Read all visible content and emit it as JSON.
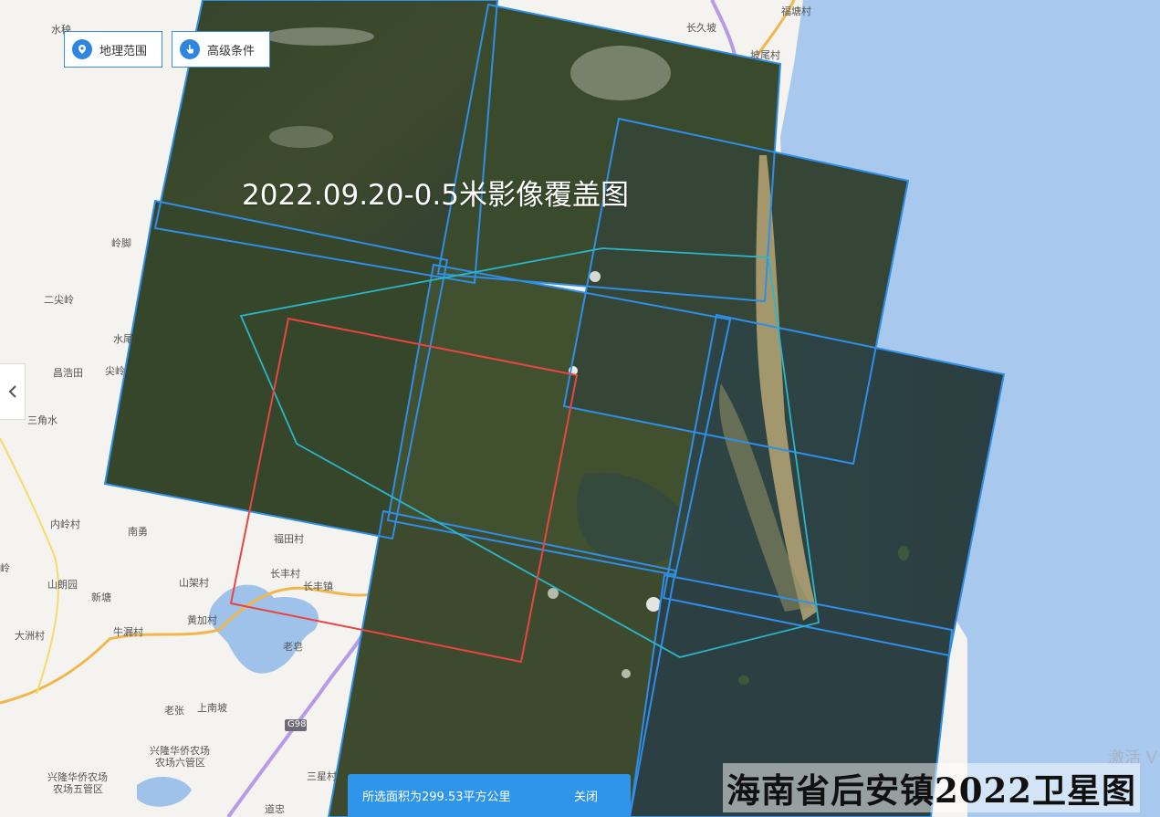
{
  "controls": {
    "geo_range_label": "地理范围",
    "advanced_label": "高级条件"
  },
  "overlay": {
    "title": "2022.09.20-0.5米影像覆盖图"
  },
  "status_bar": {
    "area_text": "所选面积为299.53平方公里",
    "close_label": "关闭"
  },
  "watermark": "海南省后安镇2022卫星图",
  "activate_text": "激活 V",
  "places": [
    {
      "name": "水秧"
    },
    {
      "name": "岭脚"
    },
    {
      "name": "二尖岭"
    },
    {
      "name": "水尾"
    },
    {
      "name": "昌浩田"
    },
    {
      "name": "尖岭"
    },
    {
      "name": "三角水"
    },
    {
      "name": "内岭村"
    },
    {
      "name": "南勇"
    },
    {
      "name": "福田村"
    },
    {
      "name": "长丰村"
    },
    {
      "name": "长丰镇"
    },
    {
      "name": "山架村"
    },
    {
      "name": "山朗园"
    },
    {
      "name": "新塘"
    },
    {
      "name": "大洲村"
    },
    {
      "name": "牛漏村"
    },
    {
      "name": "黄加村"
    },
    {
      "name": "老皂"
    },
    {
      "name": "老张"
    },
    {
      "name": "上南坡"
    },
    {
      "name": "兴隆华侨农场"
    },
    {
      "name": "农场六管区"
    },
    {
      "name": "兴隆华侨农场"
    },
    {
      "name": "农场五管区"
    },
    {
      "name": "三星村"
    },
    {
      "name": "道忠"
    },
    {
      "name": "长久坡"
    },
    {
      "name": "福塘村"
    },
    {
      "name": "坡尾村"
    },
    {
      "name": "G98"
    },
    {
      "name": "岭"
    }
  ],
  "colors": {
    "sea": "#a9c8ee",
    "land": "#f4f3ef",
    "footprint": "#2f8fe8",
    "selection": "#e84545",
    "aoi": "#2bb6c9",
    "imagery": "#3a4a2e"
  }
}
